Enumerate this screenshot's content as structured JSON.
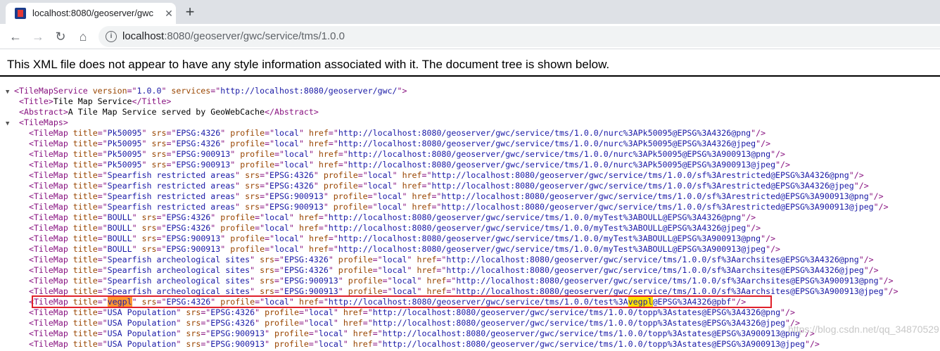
{
  "tab": {
    "title": "localhost:8080/geoserver/gwc",
    "close": "✕",
    "new_tab": "+"
  },
  "toolbar": {
    "back": "←",
    "forward": "→",
    "reload": "↻",
    "home": "⌂",
    "info": "i",
    "url_host": "localhost",
    "url_rest": ":8080/geoserver/gwc/service/tms/1.0.0"
  },
  "notice": "This XML file does not appear to have any style information associated with it. The document tree is shown below.",
  "xml": {
    "root_open_name": "TileMapService",
    "root_attrs": [
      {
        "name": "version",
        "value": "1.0.0"
      },
      {
        "name": "services",
        "value": "http://localhost:8080/geoserver/gwc/"
      }
    ],
    "title_tag": "Title",
    "title_text": "Tile Map Service",
    "abstract_tag": "Abstract",
    "abstract_text": "A Tile Map Service served by GeoWebCache",
    "tilemaps_tag": "TileMaps",
    "tilemap_tag": "TileMap",
    "tilemaps": [
      {
        "title": "Pk50095",
        "srs": "EPSG:4326",
        "profile": "local",
        "href": "http://localhost:8080/geoserver/gwc/service/tms/1.0.0/nurc%3APk50095@EPSG%3A4326@png"
      },
      {
        "title": "Pk50095",
        "srs": "EPSG:4326",
        "profile": "local",
        "href": "http://localhost:8080/geoserver/gwc/service/tms/1.0.0/nurc%3APk50095@EPSG%3A4326@jpeg"
      },
      {
        "title": "Pk50095",
        "srs": "EPSG:900913",
        "profile": "local",
        "href": "http://localhost:8080/geoserver/gwc/service/tms/1.0.0/nurc%3APk50095@EPSG%3A900913@png"
      },
      {
        "title": "Pk50095",
        "srs": "EPSG:900913",
        "profile": "local",
        "href": "http://localhost:8080/geoserver/gwc/service/tms/1.0.0/nurc%3APk50095@EPSG%3A900913@jpeg"
      },
      {
        "title": "Spearfish restricted areas",
        "srs": "EPSG:4326",
        "profile": "local",
        "href": "http://localhost:8080/geoserver/gwc/service/tms/1.0.0/sf%3Arestricted@EPSG%3A4326@png"
      },
      {
        "title": "Spearfish restricted areas",
        "srs": "EPSG:4326",
        "profile": "local",
        "href": "http://localhost:8080/geoserver/gwc/service/tms/1.0.0/sf%3Arestricted@EPSG%3A4326@jpeg"
      },
      {
        "title": "Spearfish restricted areas",
        "srs": "EPSG:900913",
        "profile": "local",
        "href": "http://localhost:8080/geoserver/gwc/service/tms/1.0.0/sf%3Arestricted@EPSG%3A900913@png"
      },
      {
        "title": "Spearfish restricted areas",
        "srs": "EPSG:900913",
        "profile": "local",
        "href": "http://localhost:8080/geoserver/gwc/service/tms/1.0.0/sf%3Arestricted@EPSG%3A900913@jpeg"
      },
      {
        "title": "BOULL",
        "srs": "EPSG:4326",
        "profile": "local",
        "href": "http://localhost:8080/geoserver/gwc/service/tms/1.0.0/myTest%3ABOULL@EPSG%3A4326@png"
      },
      {
        "title": "BOULL",
        "srs": "EPSG:4326",
        "profile": "local",
        "href": "http://localhost:8080/geoserver/gwc/service/tms/1.0.0/myTest%3ABOULL@EPSG%3A4326@jpeg"
      },
      {
        "title": "BOULL",
        "srs": "EPSG:900913",
        "profile": "local",
        "href": "http://localhost:8080/geoserver/gwc/service/tms/1.0.0/myTest%3ABOULL@EPSG%3A900913@png"
      },
      {
        "title": "BOULL",
        "srs": "EPSG:900913",
        "profile": "local",
        "href": "http://localhost:8080/geoserver/gwc/service/tms/1.0.0/myTest%3ABOULL@EPSG%3A900913@jpeg"
      },
      {
        "title": "Spearfish archeological sites",
        "srs": "EPSG:4326",
        "profile": "local",
        "href": "http://localhost:8080/geoserver/gwc/service/tms/1.0.0/sf%3Aarchsites@EPSG%3A4326@png"
      },
      {
        "title": "Spearfish archeological sites",
        "srs": "EPSG:4326",
        "profile": "local",
        "href": "http://localhost:8080/geoserver/gwc/service/tms/1.0.0/sf%3Aarchsites@EPSG%3A4326@jpeg"
      },
      {
        "title": "Spearfish archeological sites",
        "srs": "EPSG:900913",
        "profile": "local",
        "href": "http://localhost:8080/geoserver/gwc/service/tms/1.0.0/sf%3Aarchsites@EPSG%3A900913@png"
      },
      {
        "title": "Spearfish archeological sites",
        "srs": "EPSG:900913",
        "profile": "local",
        "href": "http://localhost:8080/geoserver/gwc/service/tms/1.0.0/sf%3Aarchsites@EPSG%3A900913@jpeg"
      },
      {
        "title": "vegpl",
        "srs": "EPSG:4326",
        "profile": "local",
        "href": "http://localhost:8080/geoserver/gwc/service/tms/1.0.0/test%3Avegpl@EPSG%3A4326@pbf",
        "highlight": "vegpl"
      },
      {
        "title": "USA Population",
        "srs": "EPSG:4326",
        "profile": "local",
        "href": "http://localhost:8080/geoserver/gwc/service/tms/1.0.0/topp%3Astates@EPSG%3A4326@png"
      },
      {
        "title": "USA Population",
        "srs": "EPSG:4326",
        "profile": "local",
        "href": "http://localhost:8080/geoserver/gwc/service/tms/1.0.0/topp%3Astates@EPSG%3A4326@jpeg"
      },
      {
        "title": "USA Population",
        "srs": "EPSG:900913",
        "profile": "local",
        "href": "http://localhost:8080/geoserver/gwc/service/tms/1.0.0/topp%3Astates@EPSG%3A900913@png"
      },
      {
        "title": "USA Population",
        "srs": "EPSG:900913",
        "profile": "local",
        "href": "http://localhost:8080/geoserver/gwc/service/tms/1.0.0/topp%3Astates@EPSG%3A900913@jpeg"
      }
    ]
  },
  "watermark": "https://blog.csdn.net/qq_34870529"
}
